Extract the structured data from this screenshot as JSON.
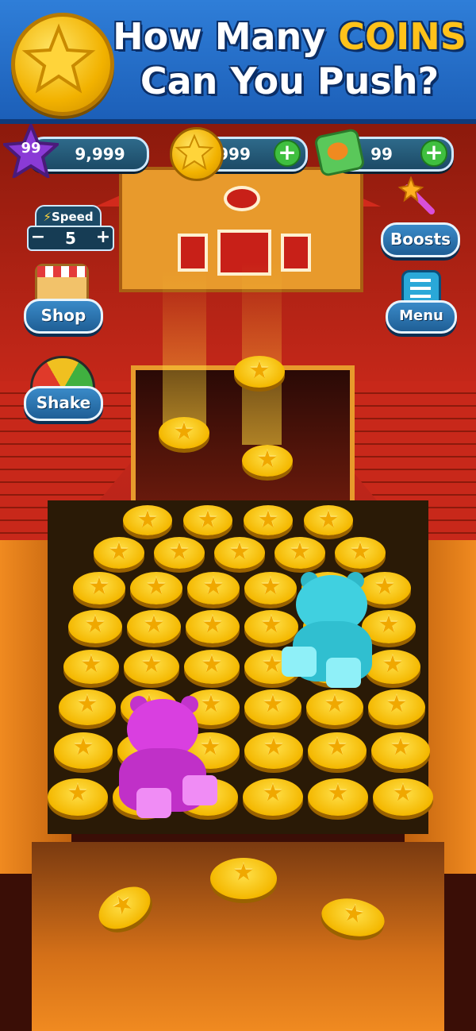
{
  "banner": {
    "line1_prefix": "How Many ",
    "line1_highlight": "COINS",
    "line2": "Can You Push?"
  },
  "hud": {
    "level": "99",
    "xp": "9,999",
    "coins": "999",
    "cash": "99",
    "speed_label": "Speed",
    "speed_value": "5",
    "speed_minus": "−",
    "speed_plus": "+",
    "plus_symbol": "+"
  },
  "buttons": {
    "boosts": "Boosts",
    "shop": "Shop",
    "menu": "Menu",
    "shake": "Shake"
  },
  "colors": {
    "banner": "#2f7ed8",
    "coin": "#f4b800",
    "bear_pink": "#d93fe0",
    "bear_cyan": "#40d0e0"
  },
  "icons": {
    "level": "purple-star-icon",
    "coins": "gold-coin-icon",
    "cash": "cash-stack-icon",
    "boosts": "magic-wand-icon",
    "shop": "shop-stall-icon",
    "menu": "list-menu-icon",
    "shake": "shake-gauge-icon",
    "speed": "lightning-icon"
  }
}
